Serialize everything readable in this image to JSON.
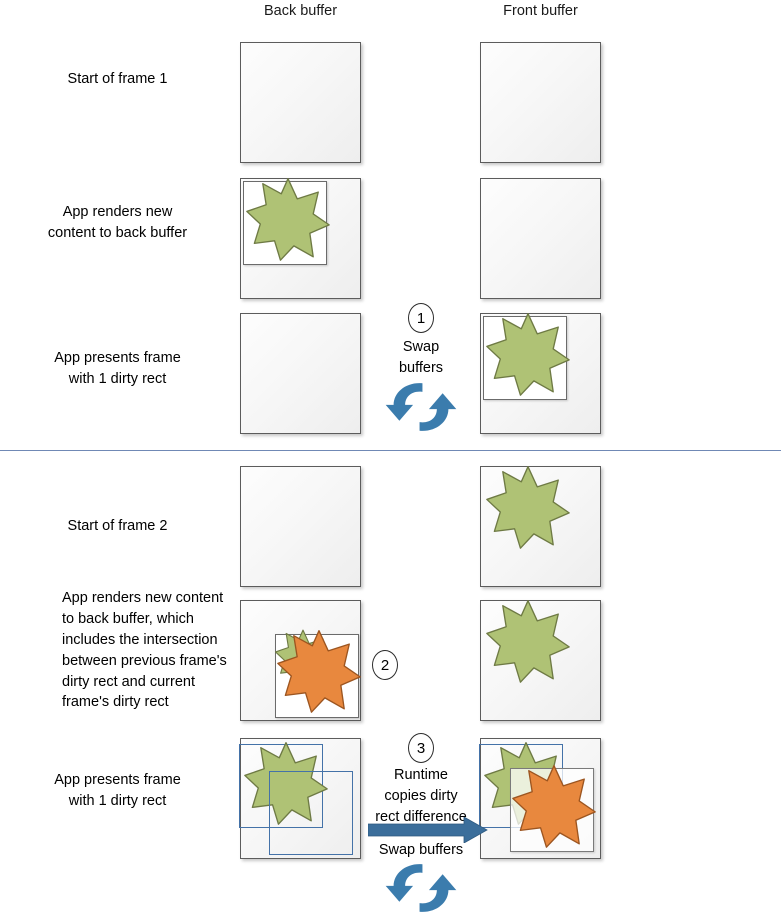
{
  "headers": {
    "back_buffer": "Back buffer",
    "front_buffer": "Front buffer"
  },
  "rows": [
    {
      "id": "start-frame-1",
      "label": "Start of frame 1"
    },
    {
      "id": "render-frame-1",
      "label": "App renders new\ncontent to back buffer"
    },
    {
      "id": "present-frame-1",
      "label": "App presents frame\nwith 1 dirty rect"
    },
    {
      "id": "start-frame-2",
      "label": "Start of frame 2"
    },
    {
      "id": "render-frame-2",
      "label": "App renders new content to back buffer, which includes the intersection between previous frame's dirty rect and current frame's dirty rect"
    },
    {
      "id": "present-frame-2",
      "label": "App presents frame\nwith 1 dirty rect"
    }
  ],
  "row_labels": {
    "start_frame_1": "Start of frame 1",
    "render_frame_1_line1": "App renders new",
    "render_frame_1_line2": "content to back buffer",
    "present_frame_1_line1": "App presents frame",
    "present_frame_1_line2": "with 1 dirty rect",
    "start_frame_2": "Start of frame 2",
    "render_frame_2": "App renders new content to back buffer, which includes the intersection between previous frame's dirty rect and current frame's dirty rect",
    "present_frame_2_line1": "App presents frame",
    "present_frame_2_line2": "with 1 dirty rect"
  },
  "steps": {
    "one": "1",
    "two": "2",
    "three": "3"
  },
  "captions": {
    "swap_buffers_1_line1": "Swap",
    "swap_buffers_1_line2": "buffers",
    "runtime_copies_line1": "Runtime",
    "runtime_copies_line2": "copies dirty",
    "runtime_copies_line3": "rect difference",
    "swap_buffers_2": "Swap buffers"
  },
  "icons": {
    "swap_buffers_icon": "swap-buffers-circular-arrows-icon",
    "copy_arrow_icon": "right-arrow-icon"
  },
  "colors": {
    "green_star_fill": "#AFC275",
    "green_star_stroke": "#6E7A44",
    "orange_star_fill": "#E8883E",
    "orange_star_stroke": "#9C5520",
    "swap_blue": "#3B7CAD",
    "copy_arrow_blue": "#3B6E9B",
    "dirty_rect_outline": "#4472A8",
    "divider": "#7089B5",
    "buffer_border": "#5C5C5C",
    "buffer_fill": "#F4F4F4"
  }
}
